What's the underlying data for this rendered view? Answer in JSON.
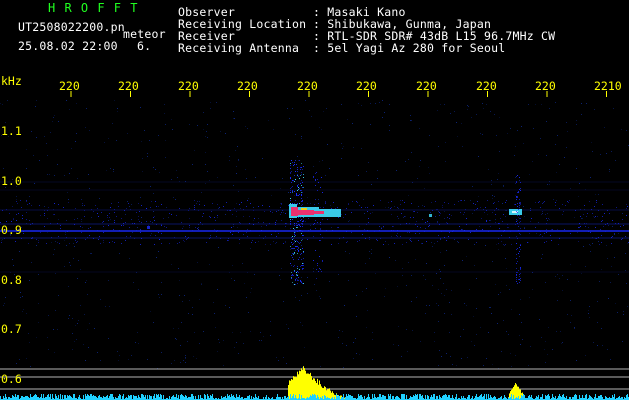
{
  "header": {
    "app_title": "H R O F F T",
    "file_name": "UT2508022200.pn",
    "meteor_label": "meteor",
    "datetime": "25.08.02 22:00",
    "count": "6.",
    "info_labels": [
      "Observer",
      "Receiving Location",
      "Receiver",
      "Receiving Antenna"
    ],
    "info_values": [
      ": Masaki Kano",
      ": Shibukawa, Gunma, Japan",
      ": RTL-SDR SDR# 43dB L15 96.7MHz CW",
      ": 5el Yagi Az 280 for Seoul"
    ]
  },
  "axis": {
    "unit": "kHz",
    "y_ticks": [
      "1.1",
      "1.0",
      "0.9",
      "0.8",
      "0.7",
      "0.6"
    ],
    "x_ticks": [
      "220",
      "220",
      "220",
      "220",
      "220",
      "220",
      "220",
      "220",
      "220",
      "2210"
    ]
  },
  "colors": {
    "background": "#000000",
    "text": "#ffffff",
    "title": "#20ff20",
    "axis": "#ffff00",
    "noise": "#1a2cff",
    "echo_core": "#ff2060",
    "echo_glow": "#40e0ff",
    "baseline": "#20d0ff"
  }
}
